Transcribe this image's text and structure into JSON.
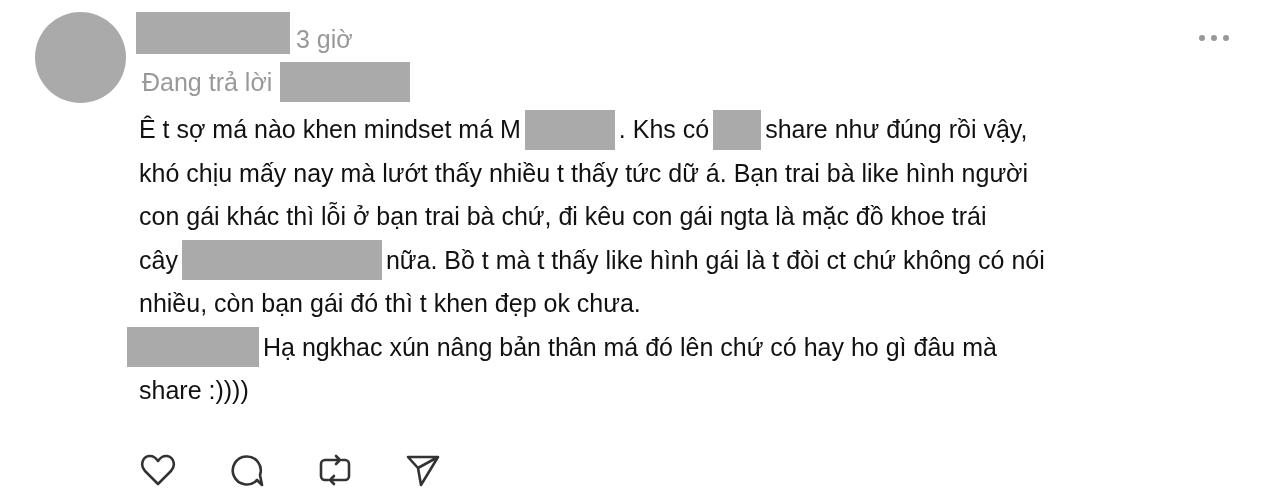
{
  "comment": {
    "time": "3 giờ",
    "reply_label": "Đang trả lời",
    "paragraphs": [
      [
        [
          {
            "kind": "text",
            "text": "Ê t sợ má nào khen mindset má M"
          },
          {
            "kind": "redacted"
          },
          {
            "kind": "text",
            "text": ". Khs có"
          },
          {
            "kind": "redacted"
          },
          {
            "kind": "text",
            "text": "share như đúng rồi vậy,"
          }
        ],
        [
          {
            "kind": "text",
            "text": "khó chịu mấy nay mà lướt thấy nhiều t thấy tức dữ á. Bạn trai bà like hình người"
          }
        ],
        [
          {
            "kind": "text",
            "text": "con gái khác thì lỗi ở bạn trai bà chứ, đi kêu con gái ngta là mặc đồ khoe trái"
          }
        ],
        [
          {
            "kind": "text",
            "text": "cây"
          },
          {
            "kind": "redacted"
          },
          {
            "kind": "text",
            "text": "nữa. Bồ t mà t thấy like hình gái là t đòi ct chứ không có nói"
          }
        ],
        [
          {
            "kind": "text",
            "text": "nhiều, còn bạn gái đó thì t khen đẹp ok chưa."
          }
        ]
      ],
      [
        [
          {
            "kind": "redacted"
          },
          {
            "kind": "text",
            "text": "Hạ ngkhac xún nâng bản thân má đó lên chứ có hay ho gì đâu mà"
          }
        ],
        [
          {
            "kind": "text",
            "text": "share :))))"
          }
        ]
      ]
    ]
  }
}
